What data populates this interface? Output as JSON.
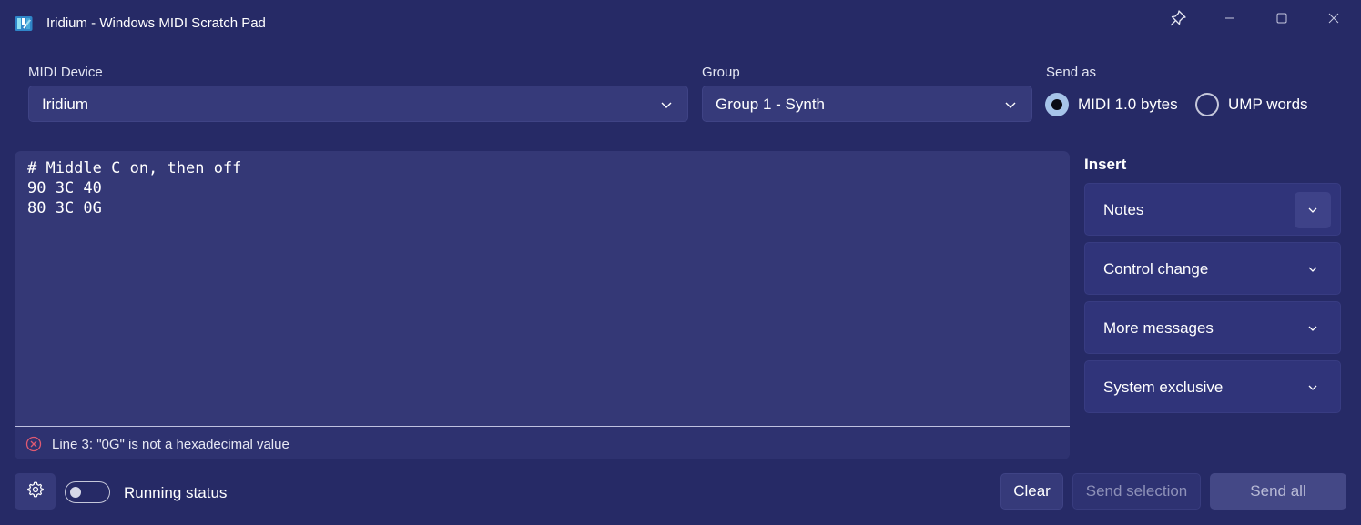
{
  "window": {
    "title": "Iridium - Windows MIDI Scratch Pad",
    "icon": "midi-app-icon",
    "controls": [
      "pin-icon",
      "minimize-icon",
      "maximize-icon",
      "close-icon"
    ]
  },
  "device": {
    "label": "MIDI Device",
    "selected": "Iridium"
  },
  "group": {
    "label": "Group",
    "selected": "Group 1 - Synth"
  },
  "send_as": {
    "label": "Send as",
    "options": [
      {
        "label": "MIDI 1.0 bytes",
        "selected": true
      },
      {
        "label": "UMP words",
        "selected": false
      }
    ]
  },
  "editor": {
    "lines": [
      "# Middle C on, then off",
      "90 3C 40",
      "80 3C 0G"
    ],
    "error": "Line 3: \"0G\" is not a hexadecimal value"
  },
  "insert": {
    "title": "Insert",
    "sections": [
      {
        "label": "Notes",
        "icon": "chevron-down-icon"
      },
      {
        "label": "Control change",
        "icon": "chevron-down-icon"
      },
      {
        "label": "More messages",
        "icon": "chevron-down-icon"
      },
      {
        "label": "System exclusive",
        "icon": "chevron-down-icon"
      }
    ]
  },
  "footer": {
    "settings_icon": "gear-icon",
    "running_status": {
      "label": "Running status",
      "on": false
    },
    "clear": "Clear",
    "send_selection": "Send selection",
    "send_all": "Send all"
  },
  "colors": {
    "background": "#262a66",
    "surface": "#363a7a",
    "editor": "#343876",
    "error": "#e05a72"
  }
}
